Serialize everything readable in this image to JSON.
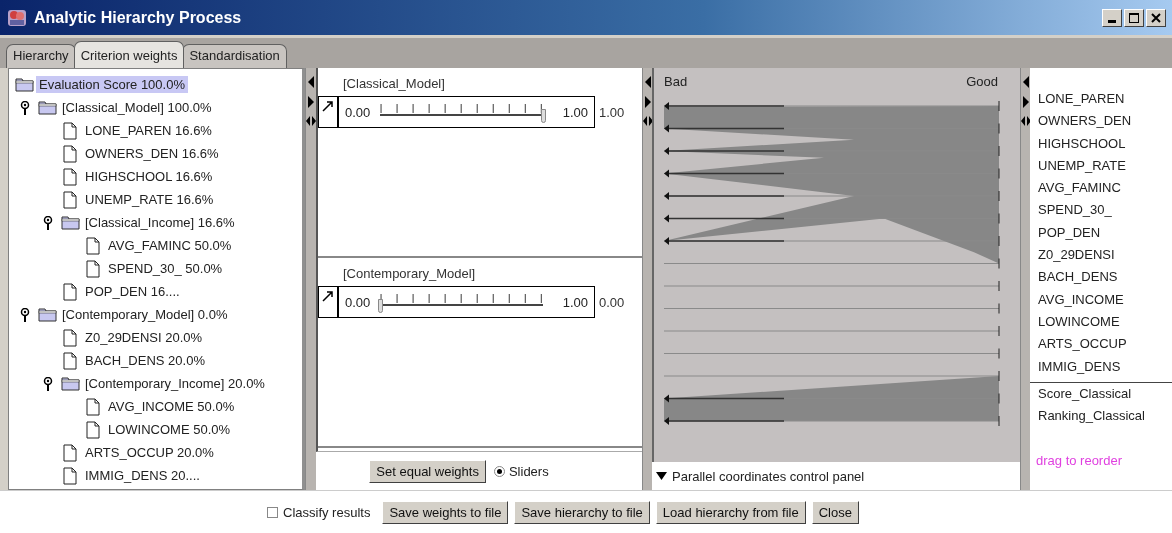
{
  "window": {
    "title": "Analytic Hierarchy Process"
  },
  "tabs": [
    {
      "label": "Hierarchy",
      "selected": false
    },
    {
      "label": "Criterion weights",
      "selected": true
    },
    {
      "label": "Standardisation",
      "selected": false
    }
  ],
  "tree": {
    "label": "Evaluation Score 100.0%",
    "kind": "folder",
    "selected": true,
    "children": [
      {
        "label": "[Classical_Model] 100.0%",
        "kind": "folder",
        "expanded": true,
        "selected": false,
        "children": [
          {
            "label": "LONE_PAREN 16.6%",
            "kind": "leaf",
            "selected": false
          },
          {
            "label": "OWNERS_DEN 16.6%",
            "kind": "leaf",
            "selected": false
          },
          {
            "label": "HIGHSCHOOL 16.6%",
            "kind": "leaf",
            "selected": false
          },
          {
            "label": "UNEMP_RATE 16.6%",
            "kind": "leaf",
            "selected": false
          },
          {
            "label": "[Classical_Income] 16.6%",
            "kind": "folder",
            "expanded": true,
            "selected": false,
            "children": [
              {
                "label": "AVG_FAMINC 50.0%",
                "kind": "leaf",
                "selected": false
              },
              {
                "label": "SPEND_30_ 50.0%",
                "kind": "leaf",
                "selected": false
              }
            ]
          },
          {
            "label": "POP_DEN 16....",
            "kind": "leaf",
            "selected": false
          }
        ]
      },
      {
        "label": "[Contemporary_Model] 0.0%",
        "kind": "folder",
        "expanded": true,
        "selected": false,
        "children": [
          {
            "label": "Z0_29DENSI 20.0%",
            "kind": "leaf",
            "selected": false
          },
          {
            "label": "BACH_DENS 20.0%",
            "kind": "leaf",
            "selected": false
          },
          {
            "label": "[Contemporary_Income] 20.0%",
            "kind": "folder",
            "expanded": true,
            "selected": false,
            "children": [
              {
                "label": "AVG_INCOME 50.0%",
                "kind": "leaf",
                "selected": false
              },
              {
                "label": "LOWINCOME 50.0%",
                "kind": "leaf",
                "selected": false
              }
            ]
          },
          {
            "label": "ARTS_OCCUP 20.0%",
            "kind": "leaf",
            "selected": false
          },
          {
            "label": "IMMIG_DENS 20....",
            "kind": "leaf",
            "selected": false
          }
        ]
      }
    ]
  },
  "weights": [
    {
      "label": "[Classical_Model]",
      "min": "0.00",
      "max": "1.00",
      "level": 1,
      "reading": "1.00"
    },
    {
      "label": "[Contemporary_Model]",
      "min": "0.00",
      "max": "1.00",
      "level": 0,
      "reading": "0.00"
    }
  ],
  "set_equal_button": "Set equal weights",
  "sliders_radio": {
    "label": "Sliders",
    "selected": true
  },
  "parallel": {
    "bad_label": "Bad",
    "good_label": "Good",
    "control_panel": {
      "label": "Parallel coordinates control panel",
      "expanded": false
    }
  },
  "variables": [
    "LONE_PAREN",
    "OWNERS_DEN",
    "HIGHSCHOOL",
    "UNEMP_RATE",
    "AVG_FAMINC",
    "SPEND_30_",
    "POP_DEN",
    "Z0_29DENSI",
    "BACH_DENS",
    "AVG_INCOME",
    "LOWINCOME",
    "ARTS_OCCUP",
    "IMMIG_DENS"
  ],
  "outputs": [
    "Score_Classical",
    "Ranking_Classical"
  ],
  "reorder_hint": "drag to reorder",
  "classify_checkbox": {
    "label": "Classify results",
    "checked": false
  },
  "buttons": [
    "Save weights to file",
    "Save hierarchy to file",
    "Load hierarchy from file",
    "Close"
  ]
}
